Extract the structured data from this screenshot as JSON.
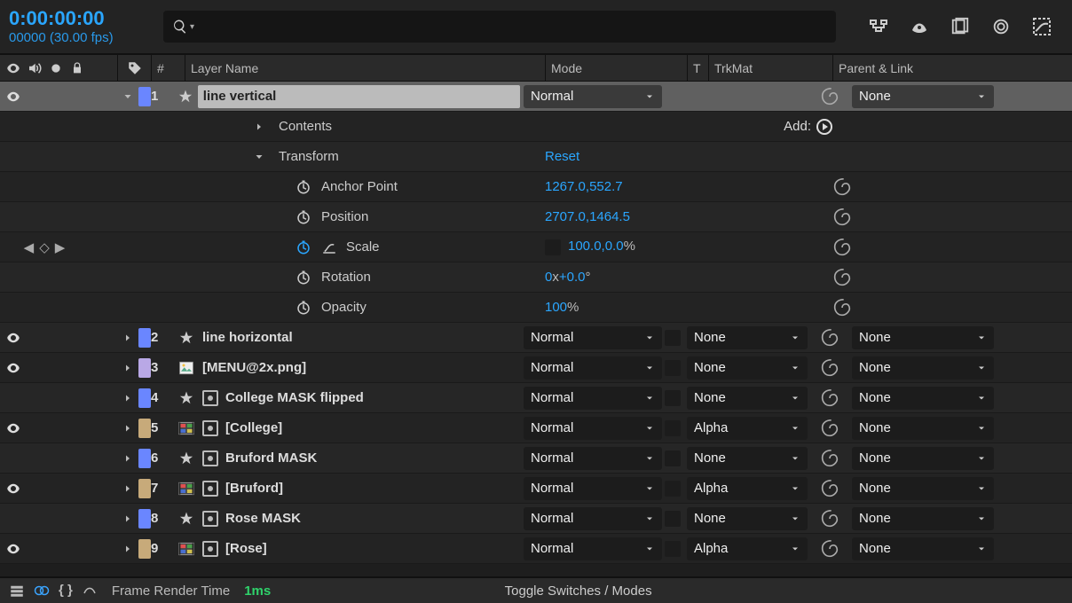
{
  "timecode": "0:00:00:00",
  "timecode_sub": "00000 (30.00 fps)",
  "search_placeholder": "",
  "columns": {
    "num": "#",
    "layer_name": "Layer Name",
    "mode": "Mode",
    "t": "T",
    "trkmat": "TrkMat",
    "parent": "Parent & Link"
  },
  "contents_label": "Contents",
  "add_label": "Add:",
  "transform": {
    "label": "Transform",
    "reset": "Reset",
    "anchor": {
      "label": "Anchor Point",
      "x": "1267.0",
      "y": "552.7"
    },
    "position": {
      "label": "Position",
      "x": "2707.0",
      "y": "1464.5"
    },
    "scale": {
      "label": "Scale",
      "x": "100.0",
      "y": "0.0",
      "suffix": "%"
    },
    "rotation": {
      "label": "Rotation",
      "revs": "0",
      "sep": "x",
      "deg": "+0.0",
      "suffix": "°"
    },
    "opacity": {
      "label": "Opacity",
      "v": "100",
      "suffix": "%"
    }
  },
  "layers": [
    {
      "num": "1",
      "name": "line vertical",
      "color": "#6a86ff",
      "icon": "shape",
      "mode": "Normal",
      "trkmat": "",
      "parent": "None",
      "eye": true,
      "selected": true
    },
    {
      "num": "2",
      "name": "line horizontal",
      "color": "#6a86ff",
      "icon": "shape",
      "mode": "Normal",
      "trkmat": "None",
      "parent": "None",
      "eye": true
    },
    {
      "num": "3",
      "name": "[MENU@2x.png]",
      "color": "#b9a8e6",
      "icon": "image",
      "mode": "Normal",
      "trkmat": "None",
      "parent": "None",
      "eye": true
    },
    {
      "num": "4",
      "name": "College MASK flipped",
      "color": "#6a86ff",
      "icon": "shape",
      "coll": true,
      "mode": "Normal",
      "trkmat": "None",
      "parent": "None",
      "eye": false
    },
    {
      "num": "5",
      "name": "[College]",
      "color": "#c7aa7a",
      "icon": "comp",
      "coll": true,
      "mode": "Normal",
      "trkmat": "Alpha",
      "parent": "None",
      "eye": true
    },
    {
      "num": "6",
      "name": "Bruford MASK",
      "color": "#6a86ff",
      "icon": "shape",
      "coll": true,
      "mode": "Normal",
      "trkmat": "None",
      "parent": "None",
      "eye": false
    },
    {
      "num": "7",
      "name": "[Bruford]",
      "color": "#c7aa7a",
      "icon": "comp",
      "coll": true,
      "mode": "Normal",
      "trkmat": "Alpha",
      "parent": "None",
      "eye": true
    },
    {
      "num": "8",
      "name": "Rose MASK",
      "color": "#6a86ff",
      "icon": "shape",
      "coll": true,
      "mode": "Normal",
      "trkmat": "None",
      "parent": "None",
      "eye": false
    },
    {
      "num": "9",
      "name": "[Rose]",
      "color": "#c7aa7a",
      "icon": "comp",
      "coll": true,
      "mode": "Normal",
      "trkmat": "Alpha",
      "parent": "None",
      "eye": true
    }
  ],
  "footer": {
    "label": "Frame Render Time",
    "time": "1ms",
    "toggle": "Toggle Switches / Modes"
  }
}
